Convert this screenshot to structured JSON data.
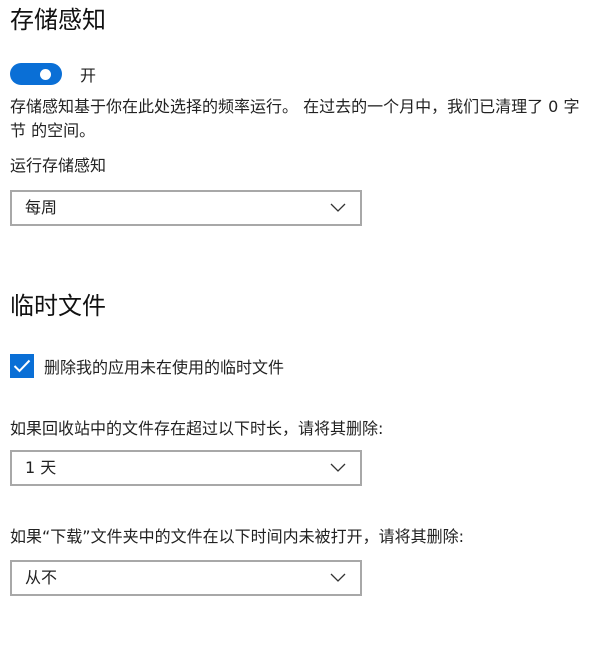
{
  "storage_sense": {
    "title": "存储感知",
    "toggle_state": "开",
    "toggle_on": true,
    "description": "存储感知基于你在此处选择的频率运行。 在过去的一个月中，我们已清理了 0 字节 的空间。",
    "run_label": "运行存储感知",
    "run_value": "每周"
  },
  "temp_files": {
    "title": "临时文件",
    "delete_unused_label": "删除我的应用未在使用的临时文件",
    "delete_unused_checked": true,
    "recycle_bin_label": "如果回收站中的文件存在超过以下时长，请将其删除:",
    "recycle_bin_value": "1 天",
    "downloads_label": "如果“下载”文件夹中的文件在以下时间内未被打开，请将其删除:",
    "downloads_value": "从不"
  },
  "colors": {
    "accent": "#0a6fd6",
    "border": "#a8a8a8"
  },
  "icons": {
    "dropdown": "chevron-down-icon",
    "check": "checkmark-icon"
  }
}
